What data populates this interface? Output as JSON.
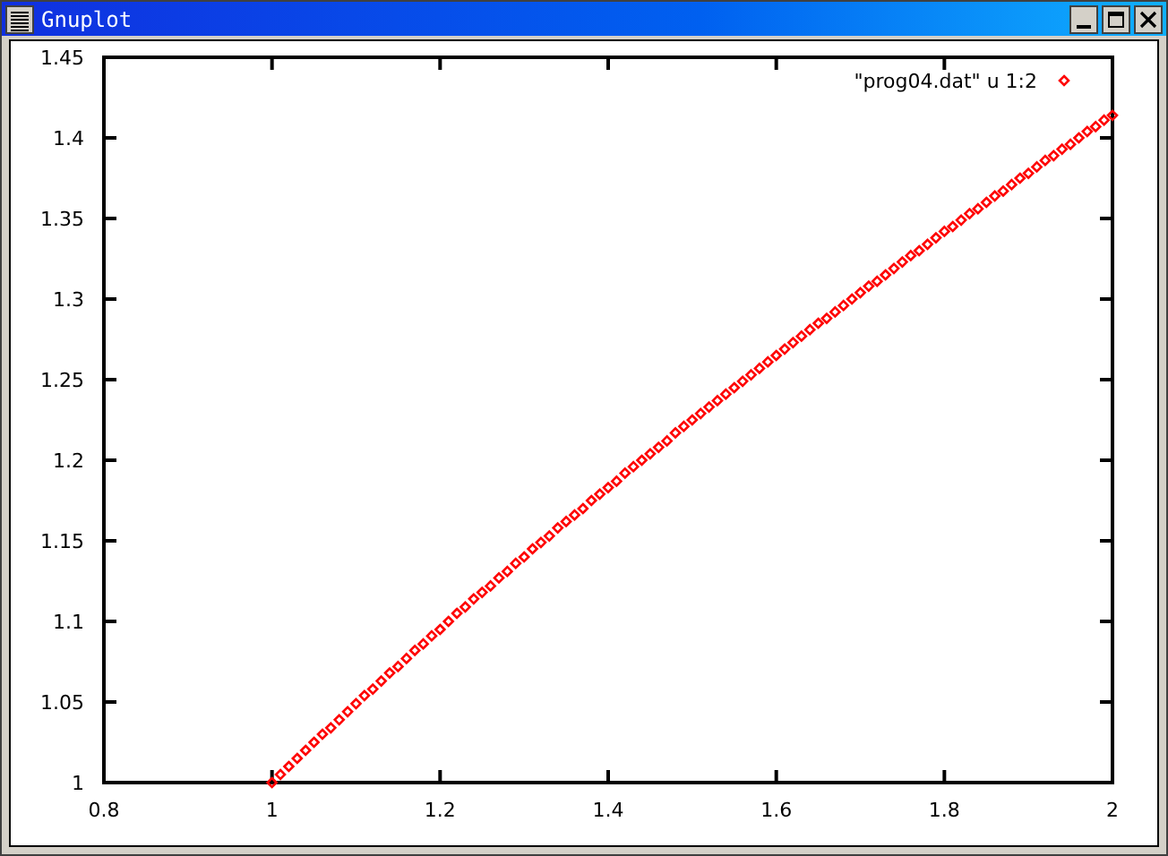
{
  "window": {
    "title": "Gnuplot"
  },
  "plot": {
    "chart_data": {
      "type": "scatter",
      "x": [
        1.0,
        1.01,
        1.02,
        1.03,
        1.04,
        1.05,
        1.06,
        1.07,
        1.08,
        1.09,
        1.1,
        1.11,
        1.12,
        1.13,
        1.14,
        1.15,
        1.16,
        1.17,
        1.18,
        1.19,
        1.2,
        1.21,
        1.22,
        1.23,
        1.24,
        1.25,
        1.26,
        1.27,
        1.28,
        1.29,
        1.3,
        1.31,
        1.32,
        1.33,
        1.34,
        1.35,
        1.36,
        1.37,
        1.38,
        1.39,
        1.4,
        1.41,
        1.42,
        1.43,
        1.44,
        1.45,
        1.46,
        1.47,
        1.48,
        1.49,
        1.5,
        1.51,
        1.52,
        1.53,
        1.54,
        1.55,
        1.56,
        1.57,
        1.58,
        1.59,
        1.6,
        1.61,
        1.62,
        1.63,
        1.64,
        1.65,
        1.66,
        1.67,
        1.68,
        1.69,
        1.7,
        1.71,
        1.72,
        1.73,
        1.74,
        1.75,
        1.76,
        1.77,
        1.78,
        1.79,
        1.8,
        1.81,
        1.82,
        1.83,
        1.84,
        1.85,
        1.86,
        1.87,
        1.88,
        1.89,
        1.9,
        1.91,
        1.92,
        1.93,
        1.94,
        1.95,
        1.96,
        1.97,
        1.98,
        1.99,
        2.0
      ],
      "series": [
        {
          "name": "\"prog04.dat\" u 1:2",
          "color": "#ff0000",
          "values": [
            1.0,
            1.005,
            1.01,
            1.015,
            1.02,
            1.025,
            1.03,
            1.034,
            1.039,
            1.044,
            1.049,
            1.054,
            1.058,
            1.063,
            1.068,
            1.072,
            1.077,
            1.082,
            1.086,
            1.091,
            1.095,
            1.1,
            1.105,
            1.109,
            1.114,
            1.118,
            1.122,
            1.127,
            1.131,
            1.136,
            1.14,
            1.145,
            1.149,
            1.153,
            1.158,
            1.162,
            1.166,
            1.17,
            1.175,
            1.179,
            1.183,
            1.187,
            1.192,
            1.196,
            1.2,
            1.204,
            1.208,
            1.212,
            1.217,
            1.221,
            1.225,
            1.229,
            1.233,
            1.237,
            1.241,
            1.245,
            1.249,
            1.253,
            1.257,
            1.261,
            1.265,
            1.269,
            1.273,
            1.277,
            1.281,
            1.285,
            1.288,
            1.292,
            1.296,
            1.3,
            1.304,
            1.308,
            1.311,
            1.315,
            1.319,
            1.323,
            1.327,
            1.33,
            1.334,
            1.338,
            1.342,
            1.345,
            1.349,
            1.353,
            1.356,
            1.36,
            1.364,
            1.367,
            1.371,
            1.375,
            1.378,
            1.382,
            1.386,
            1.389,
            1.393,
            1.396,
            1.4,
            1.404,
            1.407,
            1.411,
            1.414
          ]
        }
      ],
      "xlim": [
        0.8,
        2
      ],
      "ylim": [
        1,
        1.45
      ],
      "xticks": [
        0.8,
        1,
        1.2,
        1.4,
        1.6,
        1.8,
        2
      ],
      "yticks": [
        1,
        1.05,
        1.1,
        1.15,
        1.2,
        1.25,
        1.3,
        1.35,
        1.4,
        1.45
      ]
    }
  }
}
